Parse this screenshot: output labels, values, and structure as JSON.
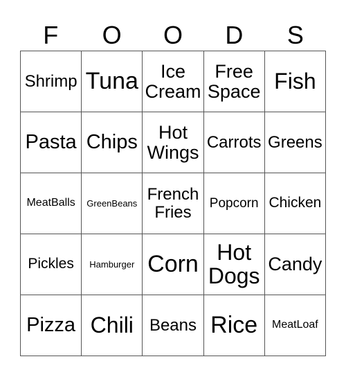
{
  "header": {
    "letters": [
      "F",
      "O",
      "O",
      "D",
      "S"
    ]
  },
  "cells": [
    [
      "Shrimp",
      "Tuna",
      "Ice\nCream",
      "Free\nSpace",
      "Fish"
    ],
    [
      "Pasta",
      "Chips",
      "Hot\nWings",
      "Carrots",
      "Greens"
    ],
    [
      "MeatBalls",
      "GreenBeans",
      "French\nFries",
      "Popcorn",
      "Chicken"
    ],
    [
      "Pickles",
      "Hamburger",
      "Corn",
      "Hot\nDogs",
      "Candy"
    ],
    [
      "Pizza",
      "Chili",
      "Beans",
      "Rice",
      "MeatLoaf"
    ]
  ]
}
